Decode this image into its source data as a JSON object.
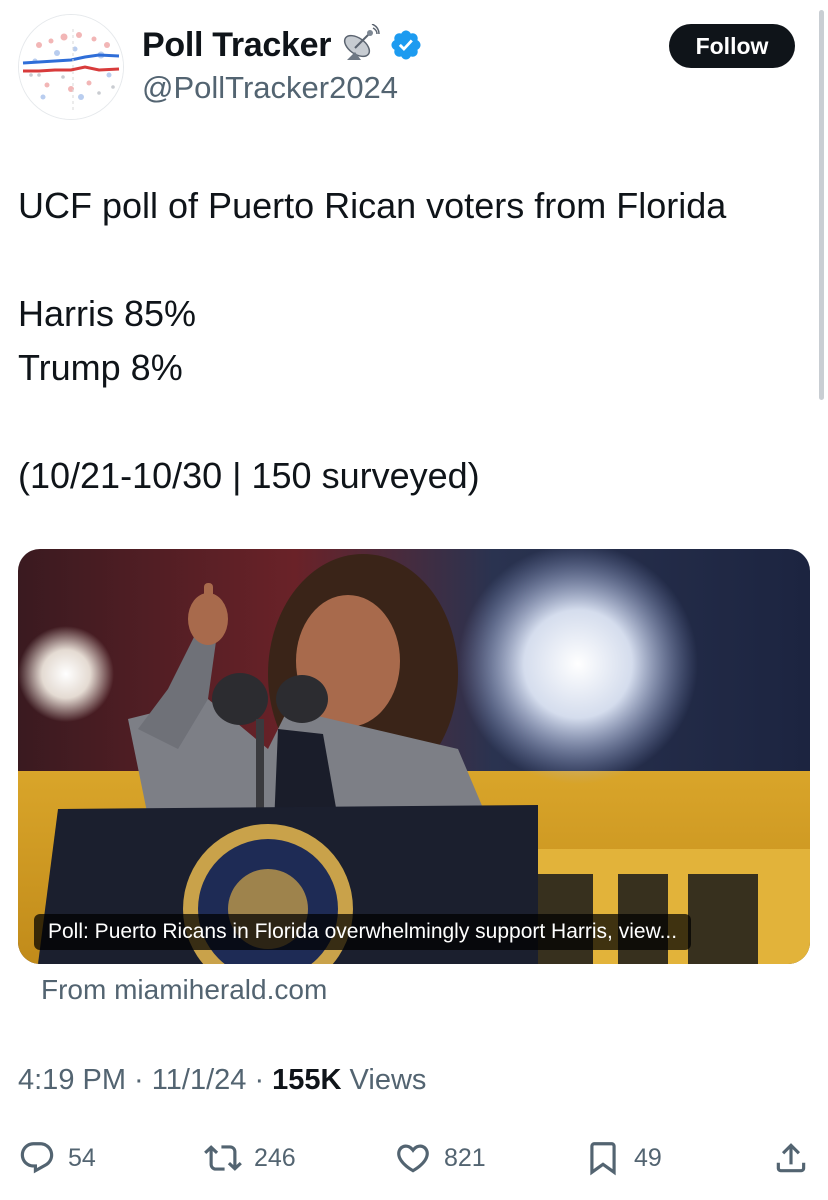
{
  "author": {
    "display_name": "Poll Tracker",
    "handle": "@PollTracker2024",
    "avatar_icon": "poll-chart-avatar",
    "badge_icon": "satellite-dish-icon",
    "verified_icon": "verified-badge-icon",
    "verified_color": "#1d9bf0"
  },
  "follow_label": "Follow",
  "tweet": {
    "line1": "UCF poll of Puerto Rican voters from Florida",
    "line2": "Harris 85%",
    "line3": "Trump 8%",
    "line4": "(10/21-10/30 | 150 surveyed)"
  },
  "card": {
    "caption": "Poll: Puerto Ricans in Florida overwhelmingly support Harris, view...",
    "source": "From miamiherald.com"
  },
  "meta": {
    "time": "4:19 PM",
    "sep1": " · ",
    "date": "11/1/24",
    "sep2": " · ",
    "views_count": "155K",
    "views_label": " Views"
  },
  "actions": {
    "replies": "54",
    "reposts": "246",
    "likes": "821",
    "bookmarks": "49"
  },
  "colors": {
    "text": "#0f1419",
    "secondary": "#536471",
    "follow_bg": "#0f1419"
  }
}
